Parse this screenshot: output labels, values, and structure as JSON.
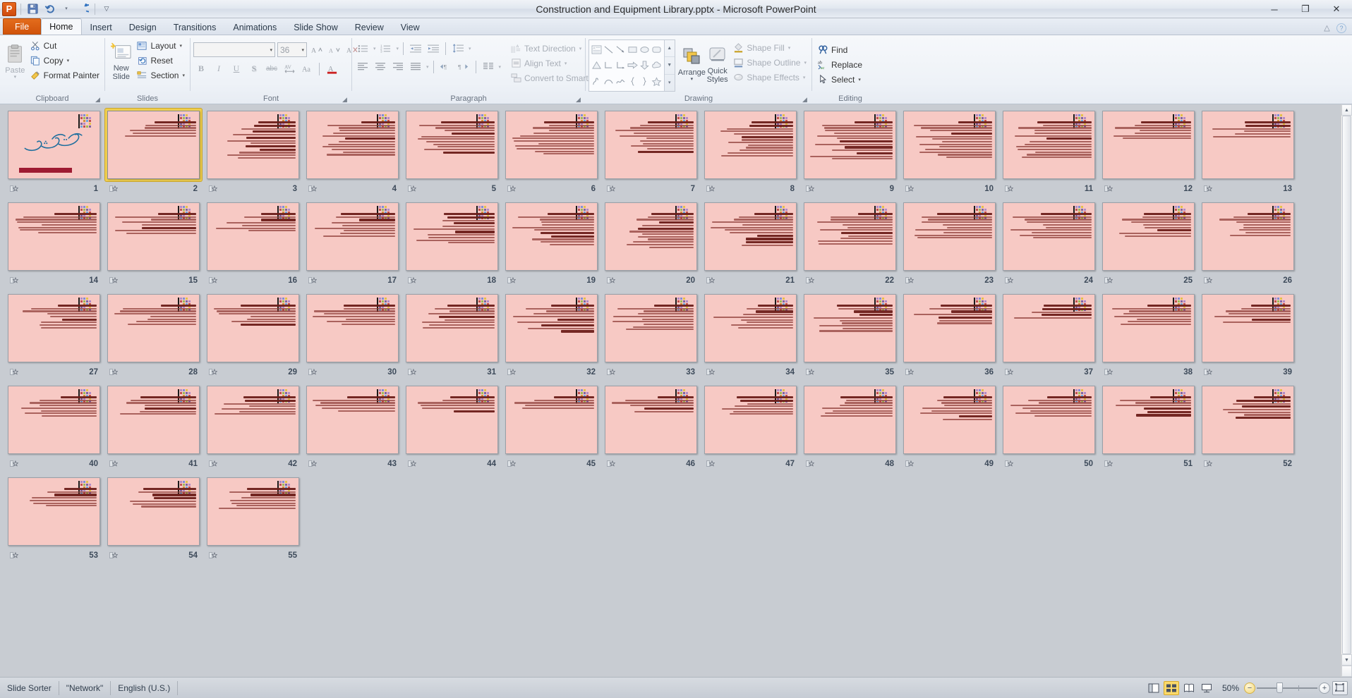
{
  "window": {
    "title": "Construction and Equipment Library.pptx  -  Microsoft PowerPoint",
    "app_logo": "P",
    "minimize": "─",
    "restore": "❐",
    "close": "✕"
  },
  "quick_access": [
    {
      "name": "save-icon",
      "glyph": "💾"
    },
    {
      "name": "undo-icon",
      "glyph": "↶"
    },
    {
      "name": "undo-dropdown-icon",
      "glyph": "▾"
    },
    {
      "name": "redo-icon",
      "glyph": "↻"
    },
    {
      "name": "customize-qat-icon",
      "glyph": "▾"
    }
  ],
  "tabs": [
    {
      "label": "File",
      "kind": "file"
    },
    {
      "label": "Home",
      "kind": "active"
    },
    {
      "label": "Insert",
      "kind": "normal"
    },
    {
      "label": "Design",
      "kind": "normal"
    },
    {
      "label": "Transitions",
      "kind": "normal"
    },
    {
      "label": "Animations",
      "kind": "normal"
    },
    {
      "label": "Slide Show",
      "kind": "normal"
    },
    {
      "label": "Review",
      "kind": "normal"
    },
    {
      "label": "View",
      "kind": "normal"
    }
  ],
  "tab_right": [
    {
      "name": "minimize-ribbon-icon",
      "glyph": "△"
    },
    {
      "name": "help-icon",
      "glyph": "?"
    }
  ],
  "ribbon": {
    "groups": [
      {
        "name": "clipboard",
        "title": "Clipboard",
        "paste": {
          "label_line1": "Paste",
          "caret": "▾"
        },
        "items": [
          {
            "label": "Cut",
            "icon": "scissors-icon",
            "glyph": "✂",
            "caret": false,
            "disabled": false
          },
          {
            "label": "Copy",
            "icon": "copy-icon",
            "glyph": "❐",
            "caret": true,
            "disabled": false
          },
          {
            "label": "Format Painter",
            "icon": "format-painter-icon",
            "glyph": "🖌",
            "caret": false,
            "disabled": false
          }
        ]
      },
      {
        "name": "slides",
        "title": "Slides",
        "new_slide": {
          "label_line1": "New",
          "label_line2": "Slide",
          "caret": "▾"
        },
        "items": [
          {
            "label": "Layout",
            "icon": "layout-icon",
            "glyph": "▤",
            "caret": true
          },
          {
            "label": "Reset",
            "icon": "reset-icon",
            "glyph": "↺",
            "caret": false
          },
          {
            "label": "Section",
            "icon": "section-icon",
            "glyph": "≣",
            "caret": true
          }
        ]
      },
      {
        "name": "font",
        "title": "Font",
        "font_name": {
          "value": "",
          "caret": "▾"
        },
        "font_size": {
          "value": "36",
          "caret": "▾"
        },
        "grow_font": {
          "name": "grow-font-icon",
          "glyph": "A▴"
        },
        "shrink_font": {
          "name": "shrink-font-icon",
          "glyph": "A▾"
        },
        "clear_formatting": {
          "name": "clear-formatting-icon",
          "glyph": "A⌫"
        },
        "buttons": [
          {
            "name": "bold-button",
            "glyph": "B"
          },
          {
            "name": "italic-button",
            "glyph": "I"
          },
          {
            "name": "underline-button",
            "glyph": "U"
          },
          {
            "name": "text-shadow-button",
            "glyph": "S"
          },
          {
            "name": "strikethrough-button",
            "glyph": "abc"
          },
          {
            "name": "character-spacing-button",
            "glyph": "AV"
          },
          {
            "name": "change-case-button",
            "glyph": "Aa"
          },
          {
            "name": "font-color-button",
            "glyph": "A"
          }
        ]
      },
      {
        "name": "paragraph",
        "title": "Paragraph",
        "row1": [
          {
            "name": "bullets-button",
            "glyph": "≣",
            "caret": true
          },
          {
            "name": "numbering-button",
            "glyph": "≣",
            "caret": true
          },
          {
            "name": "decrease-indent-button",
            "glyph": "←≡"
          },
          {
            "name": "increase-indent-button",
            "glyph": "→≡"
          },
          {
            "name": "line-spacing-button",
            "glyph": "↕≡",
            "caret": true
          }
        ],
        "row2": [
          {
            "name": "align-left-button",
            "glyph": "≡"
          },
          {
            "name": "align-center-button",
            "glyph": "≡"
          },
          {
            "name": "align-right-button",
            "glyph": "≡"
          },
          {
            "name": "justify-button",
            "glyph": "≡",
            "caret": true
          },
          {
            "name": "ltr-text-button",
            "glyph": "▶¶"
          },
          {
            "name": "rtl-text-button",
            "glyph": "¶◀"
          },
          {
            "name": "columns-button",
            "glyph": "‖‖",
            "caret": true
          }
        ],
        "side_items": [
          {
            "label": "Text Direction",
            "icon": "text-direction-icon",
            "glyph": "↕A",
            "caret": true,
            "disabled": true
          },
          {
            "label": "Align Text",
            "icon": "align-text-icon",
            "glyph": "≡",
            "caret": true,
            "disabled": true
          },
          {
            "label": "Convert to SmartArt",
            "icon": "smartart-icon",
            "glyph": "▦",
            "caret": true,
            "disabled": true
          }
        ]
      },
      {
        "name": "drawing",
        "title": "Drawing",
        "shapes": [
          {
            "name": "textbox-shape",
            "glyph": "▤"
          },
          {
            "name": "line-shape",
            "glyph": "╲"
          },
          {
            "name": "arrow-shape",
            "glyph": "↘"
          },
          {
            "name": "rectangle-shape",
            "glyph": "▭"
          },
          {
            "name": "oval-shape",
            "glyph": "⬭"
          },
          {
            "name": "rounded-rectangle-shape",
            "glyph": "▢"
          },
          {
            "name": "triangle-shape",
            "glyph": "△"
          },
          {
            "name": "elbow-connector-shape",
            "glyph": "┗"
          },
          {
            "name": "elbow-arrow-connector-shape",
            "glyph": "┗"
          },
          {
            "name": "right-arrow-shape",
            "glyph": "⇨"
          },
          {
            "name": "down-arrow-shape",
            "glyph": "⇩"
          },
          {
            "name": "cloud-shape",
            "glyph": "☁"
          },
          {
            "name": "freeform-shape",
            "glyph": "∿"
          },
          {
            "name": "curve-shape",
            "glyph": "⌒"
          },
          {
            "name": "scribble-shape",
            "glyph": "∿"
          },
          {
            "name": "left-brace-shape",
            "glyph": "{"
          },
          {
            "name": "right-brace-shape",
            "glyph": "}"
          },
          {
            "name": "star-shape",
            "glyph": "☆"
          }
        ],
        "arrange": {
          "label": "Arrange",
          "caret": "▾"
        },
        "quick_styles": {
          "label_line1": "Quick",
          "label_line2": "Styles",
          "caret": "▾"
        },
        "items": [
          {
            "label": "Shape Fill",
            "icon": "shape-fill-icon",
            "glyph": "🪣",
            "caret": true,
            "disabled": true
          },
          {
            "label": "Shape Outline",
            "icon": "shape-outline-icon",
            "glyph": "▭",
            "caret": true,
            "disabled": true
          },
          {
            "label": "Shape Effects",
            "icon": "shape-effects-icon",
            "glyph": "◑",
            "caret": true,
            "disabled": true
          }
        ]
      },
      {
        "name": "editing",
        "title": "Editing",
        "items": [
          {
            "label": "Find",
            "icon": "find-icon",
            "glyph": "🔍",
            "caret": false
          },
          {
            "label": "Replace",
            "icon": "replace-icon",
            "glyph": "ab",
            "caret": true
          },
          {
            "label": "Select",
            "icon": "select-icon",
            "glyph": "➤",
            "caret": true
          }
        ]
      }
    ]
  },
  "sorter": {
    "selected_slide": 2,
    "transition_icon": "transition-star-icon",
    "slides": [
      {
        "n": 1,
        "kind": "title"
      },
      {
        "n": 2,
        "kind": "title-body",
        "heading_lines": 1,
        "body_lines": 6
      },
      {
        "n": 3,
        "kind": "body",
        "body_lines": 13
      },
      {
        "n": 4,
        "kind": "body",
        "body_lines": 13
      },
      {
        "n": 5,
        "kind": "body",
        "body_lines": 12
      },
      {
        "n": 6,
        "kind": "body",
        "body_lines": 13
      },
      {
        "n": 7,
        "kind": "body",
        "body_lines": 12
      },
      {
        "n": 8,
        "kind": "body",
        "body_lines": 13
      },
      {
        "n": 9,
        "kind": "body",
        "body_lines": 14
      },
      {
        "n": 10,
        "kind": "body",
        "body_lines": 14
      },
      {
        "n": 11,
        "kind": "body",
        "body_lines": 14
      },
      {
        "n": 12,
        "kind": "body",
        "body_lines": 7
      },
      {
        "n": 13,
        "kind": "body",
        "body_lines": 6
      },
      {
        "n": 14,
        "kind": "body",
        "body_lines": 8
      },
      {
        "n": 15,
        "kind": "body",
        "body_lines": 8
      },
      {
        "n": 16,
        "kind": "body",
        "body_lines": 7
      },
      {
        "n": 17,
        "kind": "body",
        "body_lines": 9
      },
      {
        "n": 18,
        "kind": "body",
        "body_lines": 11
      },
      {
        "n": 19,
        "kind": "body",
        "body_lines": 12
      },
      {
        "n": 20,
        "kind": "body",
        "body_lines": 13
      },
      {
        "n": 21,
        "kind": "body",
        "body_lines": 12
      },
      {
        "n": 22,
        "kind": "body",
        "body_lines": 12
      },
      {
        "n": 23,
        "kind": "body",
        "body_lines": 10
      },
      {
        "n": 24,
        "kind": "body",
        "body_lines": 10
      },
      {
        "n": 25,
        "kind": "body",
        "body_lines": 9
      },
      {
        "n": 26,
        "kind": "body",
        "body_lines": 9
      },
      {
        "n": 27,
        "kind": "body",
        "body_lines": 9
      },
      {
        "n": 28,
        "kind": "body",
        "body_lines": 8
      },
      {
        "n": 29,
        "kind": "body",
        "body_lines": 8
      },
      {
        "n": 30,
        "kind": "body",
        "body_lines": 8
      },
      {
        "n": 31,
        "kind": "body",
        "body_lines": 9
      },
      {
        "n": 32,
        "kind": "body",
        "body_lines": 10
      },
      {
        "n": 33,
        "kind": "body",
        "body_lines": 10
      },
      {
        "n": 34,
        "kind": "body",
        "body_lines": 9
      },
      {
        "n": 35,
        "kind": "body",
        "body_lines": 10
      },
      {
        "n": 36,
        "kind": "body",
        "body_lines": 7
      },
      {
        "n": 37,
        "kind": "body",
        "body_lines": 5
      },
      {
        "n": 38,
        "kind": "body",
        "body_lines": 8
      },
      {
        "n": 39,
        "kind": "body",
        "body_lines": 7
      },
      {
        "n": 40,
        "kind": "body",
        "body_lines": 8
      },
      {
        "n": 41,
        "kind": "body",
        "body_lines": 7
      },
      {
        "n": 42,
        "kind": "body",
        "body_lines": 7
      },
      {
        "n": 43,
        "kind": "body",
        "body_lines": 6
      },
      {
        "n": 44,
        "kind": "body",
        "body_lines": 6
      },
      {
        "n": 45,
        "kind": "body",
        "body_lines": 5
      },
      {
        "n": 46,
        "kind": "body",
        "body_lines": 6
      },
      {
        "n": 47,
        "kind": "body",
        "body_lines": 7
      },
      {
        "n": 48,
        "kind": "body",
        "body_lines": 8
      },
      {
        "n": 49,
        "kind": "body",
        "body_lines": 9
      },
      {
        "n": 50,
        "kind": "body",
        "body_lines": 8
      },
      {
        "n": 51,
        "kind": "body",
        "body_lines": 7
      },
      {
        "n": 52,
        "kind": "body",
        "body_lines": 8
      },
      {
        "n": 53,
        "kind": "body",
        "body_lines": 7
      },
      {
        "n": 54,
        "kind": "body",
        "body_lines": 7
      },
      {
        "n": 55,
        "kind": "body",
        "body_lines": 8
      }
    ]
  },
  "status": {
    "view_name": "Slide Sorter",
    "theme_name": "\"Network\"",
    "language": "English (U.S.)",
    "zoom_label": "50%",
    "views": [
      {
        "name": "normal-view-button",
        "glyph": "▥",
        "active": false
      },
      {
        "name": "slide-sorter-view-button",
        "glyph": "▦",
        "active": true
      },
      {
        "name": "reading-view-button",
        "glyph": "▤",
        "active": false
      },
      {
        "name": "slide-show-button",
        "glyph": "△",
        "active": false
      }
    ],
    "zoom_out_glyph": "−",
    "zoom_in_glyph": "+",
    "fit_window_glyph": "⛶"
  },
  "colors": {
    "slide_bg": "#f7c9c4",
    "accent_orange": "#e36c1c",
    "selection_gold": "#f0cf4f",
    "text_dark": "#8c3a34"
  }
}
